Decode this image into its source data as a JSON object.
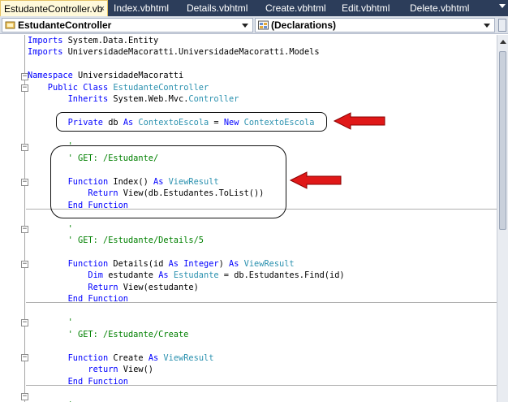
{
  "tabs": [
    {
      "label": "EstudanteController.vb",
      "active": true
    },
    {
      "label": "Index.vbhtml",
      "active": false
    },
    {
      "label": "Details.vbhtml",
      "active": false
    },
    {
      "label": "Create.vbhtml",
      "active": false
    },
    {
      "label": "Edit.vbhtml",
      "active": false
    },
    {
      "label": "Delete.vbhtml",
      "active": false
    }
  ],
  "tab_close_glyph": "×",
  "navbar": {
    "class_combo": "EstudanteController",
    "member_combo": "(Declarations)"
  },
  "code": {
    "l01_imports1_kw": "Imports",
    "l01_imports1_ns": " System.Data.Entity",
    "l02_imports2_kw": "Imports",
    "l02_imports2_ns": " UniversidadeMacoratti.UniversidadeMacoratti.Models",
    "l04_namespace_kw": "Namespace",
    "l04_namespace_name": " UniversidadeMacoratti",
    "l05_public_class_kw": "    Public Class",
    "l05_class_name": " EstudanteController",
    "l06_inherits_kw": "        Inherits",
    "l06_inherits_ns": " System.Web.Mvc.",
    "l06_inherits_type": "Controller",
    "l08_private_kw": "        Private",
    "l08_db": " db ",
    "l08_as_kw": "As",
    "l08_sp1": " ",
    "l08_type": "ContextoEscola",
    "l08_eq": " = ",
    "l08_new_kw": "New",
    "l08_sp2": " ",
    "l08_type2": "ContextoEscola",
    "l10_cm": "        '",
    "l11_cm": "        ' GET: /Estudante/",
    "l13_function_kw": "        Function",
    "l13_sig": " Index() ",
    "l13_as_kw": "As",
    "l13_sp": " ",
    "l13_type": "ViewResult",
    "l14_return_kw": "            Return",
    "l14_expr": " View(db.Estudantes.ToList())",
    "l15_end_kw": "        End Function",
    "l17_cm": "        '",
    "l18_cm": "        ' GET: /Estudante/Details/5",
    "l20_function_kw": "        Function",
    "l20_sig_a": " Details(id ",
    "l20_as_kw": "As",
    "l20_sp": " ",
    "l20_int_kw": "Integer",
    "l20_sig_b": ") ",
    "l20_as2_kw": "As",
    "l20_sp2": " ",
    "l20_type": "ViewResult",
    "l21_dim_kw": "            Dim",
    "l21_var": " estudante ",
    "l21_as_kw": "As",
    "l21_sp": " ",
    "l21_type": "Estudante",
    "l21_expr": " = db.Estudantes.Find(id)",
    "l22_return_kw": "            Return",
    "l22_expr": " View(estudante)",
    "l23_end_kw": "        End Function",
    "l25_cm": "        '",
    "l26_cm": "        ' GET: /Estudante/Create",
    "l28_function_kw": "        Function",
    "l28_sig": " Create ",
    "l28_as_kw": "As",
    "l28_sp": " ",
    "l28_type": "ViewResult",
    "l29_return_kw": "            return",
    "l29_expr": " View()",
    "l30_end_kw": "        End Function",
    "l32_cm": "        '"
  },
  "colors": {
    "keyword": "#0000ff",
    "type": "#2b91af",
    "comment": "#008000",
    "annotation_arrow": "#e01818",
    "tab_strip": "#2c3d5a"
  },
  "icons": {
    "class_combo_icon": "class-icon",
    "member_combo_icon": "declarations-icon"
  }
}
